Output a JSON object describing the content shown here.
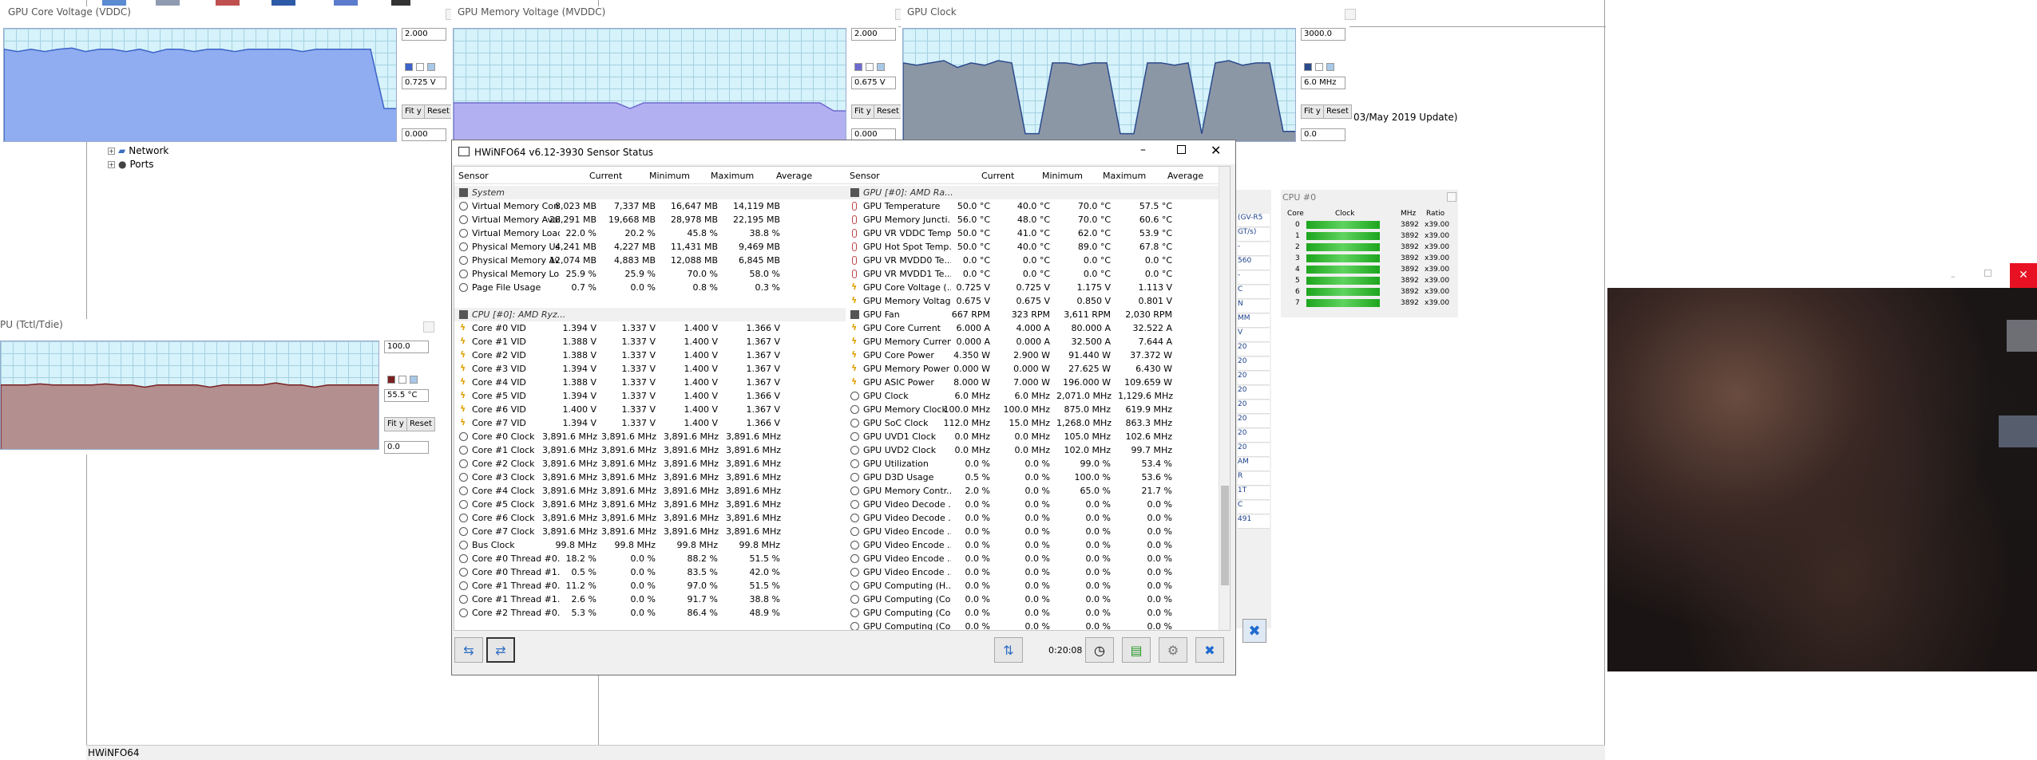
{
  "main_window": {
    "status_text": "HWiNFO64",
    "tree": [
      {
        "label": "Network"
      },
      {
        "label": "Ports"
      }
    ],
    "bios_text": "03/May 2019 Update)"
  },
  "graphs": [
    {
      "title": "GPU Core Voltage (VDDC)",
      "max": "2.000",
      "current": "0.725 V",
      "min": "0.000",
      "fit": "Fit y",
      "reset": "Reset",
      "color": "#8fadf0",
      "line": "#3c63c8"
    },
    {
      "title": "GPU Memory Voltage (MVDDC)",
      "max": "2.000",
      "current": "0.675 V",
      "min": "0.000",
      "fit": "Fit y",
      "reset": "Reset",
      "color": "#b3b0f2",
      "line": "#6f6ad0"
    },
    {
      "title": "GPU Clock",
      "max": "3000.0",
      "current": "6.0 MHz",
      "min": "0.0",
      "fit": "Fit y",
      "reset": "Reset",
      "color": "#8c97a6",
      "line": "#2b4a8c"
    },
    {
      "title": "PU (Tctl/Tdie)",
      "max": "100.0",
      "current": "55.5 °C",
      "min": "0.0",
      "fit": "Fit y",
      "reset": "Reset",
      "color": "#b38f8f",
      "line": "#7a2020"
    }
  ],
  "sensor_window": {
    "title": "HWiNFO64 v6.12-3930 Sensor Status",
    "headers": [
      "Sensor",
      "Current",
      "Minimum",
      "Maximum",
      "Average"
    ],
    "elapsed": "0:20:08",
    "left_rows": [
      {
        "t": "group",
        "n": "System"
      },
      {
        "t": "c",
        "n": "Virtual Memory Com...",
        "v": [
          "8,023 MB",
          "7,337 MB",
          "16,647 MB",
          "14,119 MB"
        ]
      },
      {
        "t": "c",
        "n": "Virtual Memory Avai...",
        "v": [
          "28,291 MB",
          "19,668 MB",
          "28,978 MB",
          "22,195 MB"
        ]
      },
      {
        "t": "c",
        "n": "Virtual Memory Load",
        "v": [
          "22.0 %",
          "20.2 %",
          "45.8 %",
          "38.8 %"
        ]
      },
      {
        "t": "c",
        "n": "Physical Memory Used",
        "v": [
          "4,241 MB",
          "4,227 MB",
          "11,431 MB",
          "9,469 MB"
        ]
      },
      {
        "t": "c",
        "n": "Physical Memory Av...",
        "v": [
          "12,074 MB",
          "4,883 MB",
          "12,088 MB",
          "6,845 MB"
        ]
      },
      {
        "t": "c",
        "n": "Physical Memory Load",
        "v": [
          "25.9 %",
          "25.9 %",
          "70.0 %",
          "58.0 %"
        ]
      },
      {
        "t": "c",
        "n": "Page File Usage",
        "v": [
          "0.7 %",
          "0.0 %",
          "0.8 %",
          "0.3 %"
        ]
      },
      {
        "t": "blank"
      },
      {
        "t": "group",
        "n": "CPU [#0]: AMD Ryz..."
      },
      {
        "t": "b",
        "n": "Core #0 VID",
        "v": [
          "1.394 V",
          "1.337 V",
          "1.400 V",
          "1.366 V"
        ]
      },
      {
        "t": "b",
        "n": "Core #1 VID",
        "v": [
          "1.388 V",
          "1.337 V",
          "1.400 V",
          "1.367 V"
        ]
      },
      {
        "t": "b",
        "n": "Core #2 VID",
        "v": [
          "1.388 V",
          "1.337 V",
          "1.400 V",
          "1.367 V"
        ]
      },
      {
        "t": "b",
        "n": "Core #3 VID",
        "v": [
          "1.394 V",
          "1.337 V",
          "1.400 V",
          "1.367 V"
        ]
      },
      {
        "t": "b",
        "n": "Core #4 VID",
        "v": [
          "1.388 V",
          "1.337 V",
          "1.400 V",
          "1.367 V"
        ]
      },
      {
        "t": "b",
        "n": "Core #5 VID",
        "v": [
          "1.394 V",
          "1.337 V",
          "1.400 V",
          "1.366 V"
        ]
      },
      {
        "t": "b",
        "n": "Core #6 VID",
        "v": [
          "1.400 V",
          "1.337 V",
          "1.400 V",
          "1.367 V"
        ]
      },
      {
        "t": "b",
        "n": "Core #7 VID",
        "v": [
          "1.394 V",
          "1.337 V",
          "1.400 V",
          "1.366 V"
        ]
      },
      {
        "t": "c",
        "n": "Core #0 Clock",
        "v": [
          "3,891.6 MHz",
          "3,891.6 MHz",
          "3,891.6 MHz",
          "3,891.6 MHz"
        ]
      },
      {
        "t": "c",
        "n": "Core #1 Clock",
        "v": [
          "3,891.6 MHz",
          "3,891.6 MHz",
          "3,891.6 MHz",
          "3,891.6 MHz"
        ]
      },
      {
        "t": "c",
        "n": "Core #2 Clock",
        "v": [
          "3,891.6 MHz",
          "3,891.6 MHz",
          "3,891.6 MHz",
          "3,891.6 MHz"
        ]
      },
      {
        "t": "c",
        "n": "Core #3 Clock",
        "v": [
          "3,891.6 MHz",
          "3,891.6 MHz",
          "3,891.6 MHz",
          "3,891.6 MHz"
        ]
      },
      {
        "t": "c",
        "n": "Core #4 Clock",
        "v": [
          "3,891.6 MHz",
          "3,891.6 MHz",
          "3,891.6 MHz",
          "3,891.6 MHz"
        ]
      },
      {
        "t": "c",
        "n": "Core #5 Clock",
        "v": [
          "3,891.6 MHz",
          "3,891.6 MHz",
          "3,891.6 MHz",
          "3,891.6 MHz"
        ]
      },
      {
        "t": "c",
        "n": "Core #6 Clock",
        "v": [
          "3,891.6 MHz",
          "3,891.6 MHz",
          "3,891.6 MHz",
          "3,891.6 MHz"
        ]
      },
      {
        "t": "c",
        "n": "Core #7 Clock",
        "v": [
          "3,891.6 MHz",
          "3,891.6 MHz",
          "3,891.6 MHz",
          "3,891.6 MHz"
        ]
      },
      {
        "t": "c",
        "n": "Bus Clock",
        "v": [
          "99.8 MHz",
          "99.8 MHz",
          "99.8 MHz",
          "99.8 MHz"
        ]
      },
      {
        "t": "c",
        "n": "Core #0 Thread #0...",
        "v": [
          "18.2 %",
          "0.0 %",
          "88.2 %",
          "51.5 %"
        ]
      },
      {
        "t": "c",
        "n": "Core #0 Thread #1...",
        "v": [
          "0.5 %",
          "0.0 %",
          "83.5 %",
          "42.0 %"
        ]
      },
      {
        "t": "c",
        "n": "Core #1 Thread #0...",
        "v": [
          "11.2 %",
          "0.0 %",
          "97.0 %",
          "51.5 %"
        ]
      },
      {
        "t": "c",
        "n": "Core #1 Thread #1...",
        "v": [
          "2.6 %",
          "0.0 %",
          "91.7 %",
          "38.8 %"
        ]
      },
      {
        "t": "c",
        "n": "Core #2 Thread #0...",
        "v": [
          "5.3 %",
          "0.0 %",
          "86.4 %",
          "48.9 %"
        ]
      }
    ],
    "right_rows": [
      {
        "t": "group",
        "n": "GPU [#0]: AMD Ra..."
      },
      {
        "t": "th",
        "n": "GPU Temperature",
        "v": [
          "50.0 °C",
          "40.0 °C",
          "70.0 °C",
          "57.5 °C"
        ]
      },
      {
        "t": "th",
        "n": "GPU Memory Juncti...",
        "v": [
          "56.0 °C",
          "48.0 °C",
          "70.0 °C",
          "60.6 °C"
        ]
      },
      {
        "t": "th",
        "n": "GPU VR VDDC Temp...",
        "v": [
          "50.0 °C",
          "41.0 °C",
          "62.0 °C",
          "53.9 °C"
        ]
      },
      {
        "t": "th",
        "n": "GPU Hot Spot Temp...",
        "v": [
          "50.0 °C",
          "40.0 °C",
          "89.0 °C",
          "67.8 °C"
        ]
      },
      {
        "t": "th",
        "n": "GPU VR MVDD0 Te...",
        "v": [
          "0.0 °C",
          "0.0 °C",
          "0.0 °C",
          "0.0 °C"
        ]
      },
      {
        "t": "th",
        "n": "GPU VR MVDD1 Te...",
        "v": [
          "0.0 °C",
          "0.0 °C",
          "0.0 °C",
          "0.0 °C"
        ]
      },
      {
        "t": "b",
        "n": "GPU Core Voltage (...",
        "v": [
          "0.725 V",
          "0.725 V",
          "1.175 V",
          "1.113 V"
        ]
      },
      {
        "t": "b",
        "n": "GPU Memory Voltag...",
        "v": [
          "0.675 V",
          "0.675 V",
          "0.850 V",
          "0.801 V"
        ]
      },
      {
        "t": "box",
        "n": "GPU Fan",
        "v": [
          "667 RPM",
          "323 RPM",
          "3,611 RPM",
          "2,030 RPM"
        ]
      },
      {
        "t": "b",
        "n": "GPU Core Current",
        "v": [
          "6.000 A",
          "4.000 A",
          "80.000 A",
          "32.522 A"
        ]
      },
      {
        "t": "b",
        "n": "GPU Memory Current",
        "v": [
          "0.000 A",
          "0.000 A",
          "32.500 A",
          "7.644 A"
        ]
      },
      {
        "t": "b",
        "n": "GPU Core Power",
        "v": [
          "4.350 W",
          "2.900 W",
          "91.440 W",
          "37.372 W"
        ]
      },
      {
        "t": "b",
        "n": "GPU Memory Power",
        "v": [
          "0.000 W",
          "0.000 W",
          "27.625 W",
          "6.430 W"
        ]
      },
      {
        "t": "b",
        "n": "GPU ASIC Power",
        "v": [
          "8.000 W",
          "7.000 W",
          "196.000 W",
          "109.659 W"
        ]
      },
      {
        "t": "c",
        "n": "GPU Clock",
        "v": [
          "6.0 MHz",
          "6.0 MHz",
          "2,071.0 MHz",
          "1,129.6 MHz"
        ]
      },
      {
        "t": "c",
        "n": "GPU Memory Clock",
        "v": [
          "100.0 MHz",
          "100.0 MHz",
          "875.0 MHz",
          "619.9 MHz"
        ]
      },
      {
        "t": "c",
        "n": "GPU SoC Clock",
        "v": [
          "112.0 MHz",
          "15.0 MHz",
          "1,268.0 MHz",
          "863.3 MHz"
        ]
      },
      {
        "t": "c",
        "n": "GPU UVD1 Clock",
        "v": [
          "0.0 MHz",
          "0.0 MHz",
          "105.0 MHz",
          "102.6 MHz"
        ]
      },
      {
        "t": "c",
        "n": "GPU UVD2 Clock",
        "v": [
          "0.0 MHz",
          "0.0 MHz",
          "102.0 MHz",
          "99.7 MHz"
        ]
      },
      {
        "t": "c",
        "n": "GPU Utilization",
        "v": [
          "0.0 %",
          "0.0 %",
          "99.0 %",
          "53.4 %"
        ]
      },
      {
        "t": "c",
        "n": "GPU D3D Usage",
        "v": [
          "0.5 %",
          "0.0 %",
          "100.0 %",
          "53.6 %"
        ]
      },
      {
        "t": "c",
        "n": "GPU Memory Contr...",
        "v": [
          "2.0 %",
          "0.0 %",
          "65.0 %",
          "21.7 %"
        ]
      },
      {
        "t": "c",
        "n": "GPU Video Decode ...",
        "v": [
          "0.0 %",
          "0.0 %",
          "0.0 %",
          "0.0 %"
        ]
      },
      {
        "t": "c",
        "n": "GPU Video Decode ...",
        "v": [
          "0.0 %",
          "0.0 %",
          "0.0 %",
          "0.0 %"
        ]
      },
      {
        "t": "c",
        "n": "GPU Video Encode ...",
        "v": [
          "0.0 %",
          "0.0 %",
          "0.0 %",
          "0.0 %"
        ]
      },
      {
        "t": "c",
        "n": "GPU Video Encode ...",
        "v": [
          "0.0 %",
          "0.0 %",
          "0.0 %",
          "0.0 %"
        ]
      },
      {
        "t": "c",
        "n": "GPU Video Encode ...",
        "v": [
          "0.0 %",
          "0.0 %",
          "0.0 %",
          "0.0 %"
        ]
      },
      {
        "t": "c",
        "n": "GPU Video Encode ...",
        "v": [
          "0.0 %",
          "0.0 %",
          "0.0 %",
          "0.0 %"
        ]
      },
      {
        "t": "c",
        "n": "GPU Computing (H...",
        "v": [
          "0.0 %",
          "0.0 %",
          "0.0 %",
          "0.0 %"
        ]
      },
      {
        "t": "c",
        "n": "GPU Computing (Co...",
        "v": [
          "0.0 %",
          "0.0 %",
          "0.0 %",
          "0.0 %"
        ]
      },
      {
        "t": "c",
        "n": "GPU Computing (Co...",
        "v": [
          "0.0 %",
          "0.0 %",
          "0.0 %",
          "0.0 %"
        ]
      },
      {
        "t": "c",
        "n": "GPU Computing (Co...",
        "v": [
          "0.0 %",
          "0.0 %",
          "0.0 %",
          "0.0 %"
        ]
      }
    ]
  },
  "cpu_panel": {
    "title": "CPU #0",
    "headers": [
      "Core",
      "Clock",
      "MHz",
      "Ratio"
    ],
    "rows": [
      {
        "core": "0",
        "mhz": "3892",
        "ratio": "x39.00"
      },
      {
        "core": "1",
        "mhz": "3892",
        "ratio": "x39.00"
      },
      {
        "core": "2",
        "mhz": "3892",
        "ratio": "x39.00"
      },
      {
        "core": "3",
        "mhz": "3892",
        "ratio": "x39.00"
      },
      {
        "core": "4",
        "mhz": "3892",
        "ratio": "x39.00"
      },
      {
        "core": "5",
        "mhz": "3892",
        "ratio": "x39.00"
      },
      {
        "core": "6",
        "mhz": "3892",
        "ratio": "x39.00"
      },
      {
        "core": "7",
        "mhz": "3892",
        "ratio": "x39.00"
      }
    ]
  },
  "side_fragments": {
    "lines": [
      "(GV-R5",
      "GT/s)",
      "-",
      "560",
      "-",
      "C",
      "N",
      "MM",
      "V",
      "20",
      "20",
      "20",
      "20",
      "20",
      "20",
      "20",
      "20",
      "AM",
      "R",
      "1T",
      "C",
      "491"
    ]
  }
}
